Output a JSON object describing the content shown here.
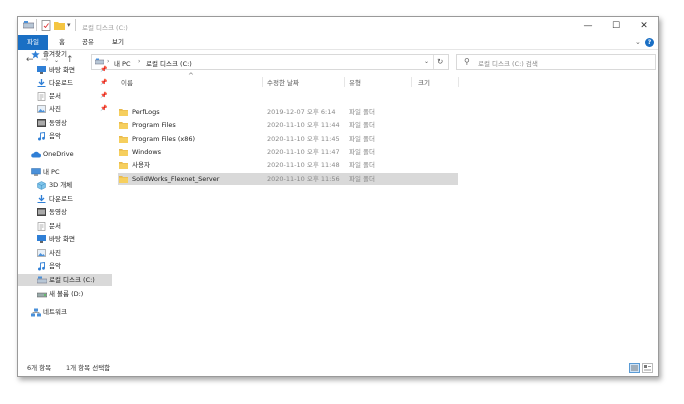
{
  "window": {
    "title": "로컬 디스크 (C:)"
  },
  "ribbon": {
    "tabs": [
      "파일",
      "홈",
      "공유",
      "보기"
    ]
  },
  "address": {
    "path": [
      "내 PC",
      "로컬 디스크 (C:)"
    ],
    "search_placeholder": "로컬 디스크 (C:) 검색"
  },
  "nav": {
    "items": [
      {
        "label": "즐겨찾기",
        "icon": "star-icon",
        "indent": 0,
        "pin": false
      },
      {
        "label": "바탕 화면",
        "icon": "desktop-icon",
        "indent": 1,
        "pin": true
      },
      {
        "label": "다운로드",
        "icon": "download-icon",
        "indent": 1,
        "pin": true
      },
      {
        "label": "문서",
        "icon": "document-icon",
        "indent": 1,
        "pin": true
      },
      {
        "label": "사진",
        "icon": "picture-icon",
        "indent": 1,
        "pin": true
      },
      {
        "label": "동영상",
        "icon": "video-icon",
        "indent": 1,
        "pin": false
      },
      {
        "label": "음악",
        "icon": "music-icon",
        "indent": 1,
        "pin": false
      },
      {
        "label": "OneDrive",
        "icon": "cloud-icon",
        "indent": 0,
        "pin": false
      },
      {
        "label": "내 PC",
        "icon": "computer-icon",
        "indent": 0,
        "pin": false
      },
      {
        "label": "3D 개체",
        "icon": "cube-icon",
        "indent": 1,
        "pin": false
      },
      {
        "label": "다운로드",
        "icon": "download-icon",
        "indent": 1,
        "pin": false
      },
      {
        "label": "동영상",
        "icon": "video-icon",
        "indent": 1,
        "pin": false
      },
      {
        "label": "문서",
        "icon": "document-icon",
        "indent": 1,
        "pin": false
      },
      {
        "label": "바탕 화면",
        "icon": "desktop-icon",
        "indent": 1,
        "pin": false
      },
      {
        "label": "사진",
        "icon": "picture-icon",
        "indent": 1,
        "pin": false
      },
      {
        "label": "음악",
        "icon": "music-icon",
        "indent": 1,
        "pin": false
      },
      {
        "label": "로컬 디스크 (C:)",
        "icon": "disk-icon",
        "indent": 1,
        "pin": false,
        "selected": true
      },
      {
        "label": "새 볼륨 (D:)",
        "icon": "drive-icon",
        "indent": 1,
        "pin": false
      },
      {
        "label": "네트워크",
        "icon": "network-icon",
        "indent": 0,
        "pin": false
      }
    ]
  },
  "columns": [
    "이름",
    "수정한 날짜",
    "유형",
    "크기"
  ],
  "files": [
    {
      "name": "PerfLogs",
      "date": "2019-12-07 오후 6:14",
      "type": "파일 폴더"
    },
    {
      "name": "Program Files",
      "date": "2020-11-10 오후 11:44",
      "type": "파일 폴더"
    },
    {
      "name": "Program Files (x86)",
      "date": "2020-11-10 오후 11:45",
      "type": "파일 폴더"
    },
    {
      "name": "Windows",
      "date": "2020-11-10 오후 11:47",
      "type": "파일 폴더"
    },
    {
      "name": "사용자",
      "date": "2020-11-10 오후 11:48",
      "type": "파일 폴더"
    },
    {
      "name": "SolidWorks_Flexnet_Server",
      "date": "2020-11-10 오후 11:56",
      "type": "파일 폴더",
      "selected": true
    }
  ],
  "status": {
    "count": "6개 항목",
    "selection": "1개 항목 선택함"
  },
  "colors": {
    "accent": "#1a6fc4",
    "folder": "#f4c542",
    "selected": "#d9d9d9"
  }
}
